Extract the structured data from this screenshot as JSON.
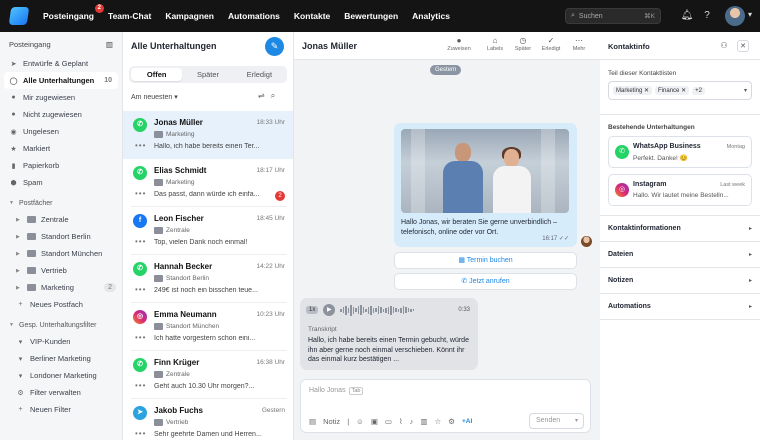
{
  "topbar": {
    "nav": [
      {
        "label": "Posteingang",
        "badge": "2"
      },
      {
        "label": "Team-Chat"
      },
      {
        "label": "Kampagnen"
      },
      {
        "label": "Automations"
      },
      {
        "label": "Kontakte"
      },
      {
        "label": "Bewertungen"
      },
      {
        "label": "Analytics"
      }
    ],
    "search_placeholder": "Suchen",
    "search_shortcut": "⌘K"
  },
  "sidebar": {
    "title": "Posteingang",
    "items": [
      {
        "label": "Entwürfe & Geplant",
        "icon": "send-icon"
      },
      {
        "label": "Alle Unterhaltungen",
        "count": "10",
        "icon": "chat-icon"
      },
      {
        "label": "Mir zugewiesen",
        "icon": "user-icon"
      },
      {
        "label": "Nicht zugewiesen",
        "icon": "user-x-icon"
      },
      {
        "label": "Ungelesen",
        "icon": "eye-icon"
      },
      {
        "label": "Markiert",
        "icon": "star-icon"
      },
      {
        "label": "Papierkorb",
        "icon": "trash-icon"
      },
      {
        "label": "Spam",
        "icon": "shield-icon"
      }
    ],
    "postfaecher_title": "Postfächer",
    "postfaecher": [
      {
        "label": "Zentrale"
      },
      {
        "label": "Standort Berlin"
      },
      {
        "label": "Standort München"
      },
      {
        "label": "Vertrieb"
      },
      {
        "label": "Marketing",
        "count": "2"
      }
    ],
    "new_postfach": "Neues Postfach",
    "filter_title": "Gesp. Unterhaltungsfilter",
    "filters": [
      {
        "label": "VIP-Kunden"
      },
      {
        "label": "Berliner Marketing"
      },
      {
        "label": "Londoner Marketing"
      },
      {
        "label": "Filter verwalten"
      },
      {
        "label": "Neuen Filter"
      }
    ]
  },
  "convlist": {
    "title": "Alle Unterhaltungen",
    "tabs": [
      "Offen",
      "Später",
      "Erledigt"
    ],
    "sort_label": "Am neuesten",
    "conversations": [
      {
        "name": "Jonas Müller",
        "time": "18:33 Uhr",
        "folder": "Marketing",
        "preview": "Hallo, ich habe bereits einen Ter...",
        "channel": "whatsapp",
        "channel_color": "#25d366"
      },
      {
        "name": "Elias Schmidt",
        "time": "18:17 Uhr",
        "folder": "Marketing",
        "preview": "Das passt, dann würde ich einfa...",
        "channel": "whatsapp",
        "channel_color": "#25d366",
        "unread": "2"
      },
      {
        "name": "Leon Fischer",
        "time": "18:45 Uhr",
        "folder": "Zentrale",
        "preview": "Top, vielen Dank noch einmal!",
        "channel": "facebook",
        "channel_color": "#1877f2"
      },
      {
        "name": "Hannah Becker",
        "time": "14:22 Uhr",
        "folder": "Standort Berlin",
        "preview": "249€ ist noch ein bisschen teue...",
        "channel": "whatsapp",
        "channel_color": "#25d366"
      },
      {
        "name": "Emma Neumann",
        "time": "10:23 Uhr",
        "folder": "Standort München",
        "preview": "Ich hatte vorgestern schon eini...",
        "channel": "instagram",
        "channel_color": "#d62976"
      },
      {
        "name": "Finn Krüger",
        "time": "16:38 Uhr",
        "folder": "Zentrale",
        "preview": "Geht auch 10.30 Uhr morgen?...",
        "channel": "whatsapp",
        "channel_color": "#25d366"
      },
      {
        "name": "Jakob Fuchs",
        "time": "Gestern",
        "folder": "Vertrieb",
        "preview": "Sehr geehrte Damen und Herren...",
        "channel": "telegram",
        "channel_color": "#2aa3df"
      }
    ]
  },
  "chat": {
    "contact_name": "Jonas Müller",
    "actions": [
      {
        "label": "Zuweisen",
        "icon": "avatar-icon"
      },
      {
        "label": "Labels",
        "icon": "tag-icon"
      },
      {
        "label": "Später",
        "icon": "clock-icon"
      },
      {
        "label": "Erledigt",
        "icon": "check-icon"
      },
      {
        "label": "Mehr",
        "icon": "more-icon"
      }
    ],
    "date_pill": "Gestern",
    "outgoing_text": "Hallo Jonas, wir beraten Sie gerne unverbindlich – telefonisch, online oder vor Ort.",
    "outgoing_time": "16:17 ✓✓",
    "quick_buttons": [
      "Termin buchen",
      "Jetzt anrufen"
    ],
    "voice_speed": "1x",
    "voice_duration": "0:33",
    "transcript_label": "Transkript",
    "incoming_text": "Hallo, ich habe bereits einen Termin gebucht, würde ihn aber gerne noch einmal verschieben. Könnt ihr das einmal kurz bestätigen ...",
    "composer_placeholder": "Hallo Jonas",
    "composer_tab": "Tab",
    "note_label": "Notiz",
    "ai_label": "+AI",
    "send_label": "Senden"
  },
  "info": {
    "title": "Kontaktinfo",
    "lists_label": "Teil dieser Kontaktlisten",
    "tags": [
      "Marketing",
      "Finance"
    ],
    "tags_more": "+2",
    "existing_label": "Bestehende Unterhaltungen",
    "existing": [
      {
        "channel": "WhatsApp Business",
        "date": "Montag",
        "preview": "Perfekt. Danke! 😊",
        "color": "#25d366"
      },
      {
        "channel": "Instagram",
        "date": "Last week",
        "preview": "Hallo. Wir lautet meine Bestelln...",
        "color": "#d62976"
      }
    ],
    "sections": [
      "Kontaktinformationen",
      "Dateien",
      "Notizen",
      "Automations"
    ]
  }
}
